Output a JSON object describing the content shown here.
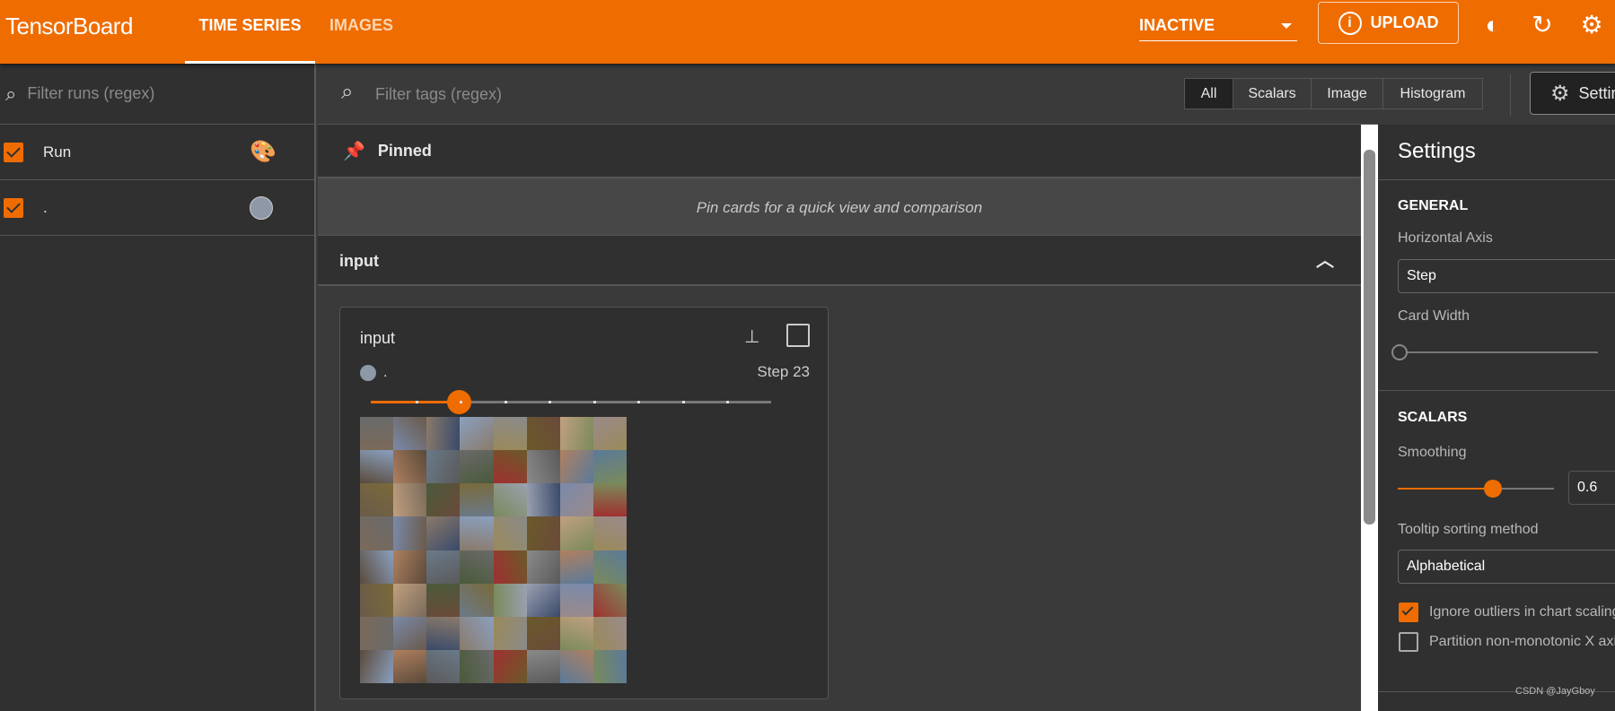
{
  "header": {
    "title": "TensorBoard",
    "tabs": [
      {
        "label": "TIME SERIES",
        "active": true
      },
      {
        "label": "IMAGES",
        "active": false
      }
    ],
    "status_select": "INACTIVE",
    "upload_label": "UPLOAD",
    "accent": "#ef6c00"
  },
  "sidebar": {
    "filter_placeholder": "Filter runs (regex)",
    "header_label": "Run",
    "runs": [
      {
        "name": ".",
        "color": "#8e99a8",
        "checked": true
      }
    ]
  },
  "main": {
    "filter_placeholder": "Filter tags (regex)",
    "filters": [
      "All",
      "Scalars",
      "Image",
      "Histogram"
    ],
    "active_filter": "All",
    "settings_button": "Settings",
    "pinned": {
      "title": "Pinned",
      "message": "Pin cards for a quick view and comparison"
    },
    "group": {
      "title": "input",
      "card": {
        "title": "input",
        "run": ".",
        "step_label": "Step 23",
        "slider_fraction": 0.22,
        "grid": "8x8"
      }
    }
  },
  "settings": {
    "title": "Settings",
    "general": "GENERAL",
    "horizontal_axis_label": "Horizontal Axis",
    "horizontal_axis": "Step",
    "card_width_label": "Card Width",
    "scalars": "SCALARS",
    "smoothing_label": "Smoothing",
    "smoothing": "0.6",
    "tooltip_label": "Tooltip sorting method",
    "tooltip_value": "Alphabetical",
    "ignore_outliers": "Ignore outliers in chart scaling",
    "ignore_outliers_checked": true,
    "partition": "Partition non-monotonic X axis",
    "partition_checked": false
  },
  "watermark": "CSDN @JayGboy"
}
